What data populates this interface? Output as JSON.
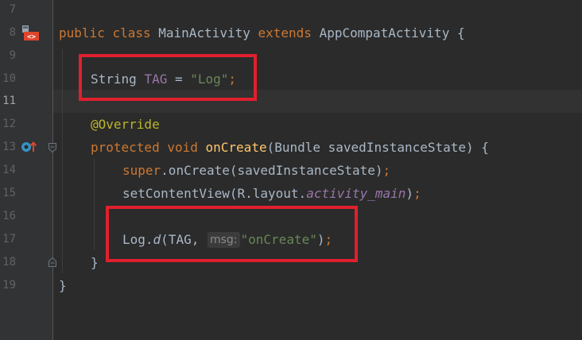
{
  "editor": {
    "line_numbers": [
      "7",
      "8",
      "9",
      "10",
      "11",
      "12",
      "13",
      "14",
      "15",
      "16",
      "17",
      "18",
      "19"
    ],
    "current_line": "11",
    "code": {
      "l8": {
        "kw1": "public",
        "kw2": "class",
        "name": "MainActivity",
        "kw3": "extends",
        "super_name": "AppCompatActivity",
        "brace": "{"
      },
      "l10": {
        "type": "String",
        "field": "TAG",
        "eq": " = ",
        "value": "\"Log\"",
        "semi": ";"
      },
      "l12": {
        "annotation": "@Override"
      },
      "l13": {
        "kw1": "protected",
        "kw2": "void",
        "method": "onCreate",
        "params": "(Bundle savedInstanceState) {"
      },
      "l14": {
        "kw": "super",
        "rest": ".onCreate(savedInstanceState)",
        "semi": ";"
      },
      "l15": {
        "call": "setContentView(R.layout.",
        "field": "activity_main",
        "close": ")",
        "semi": ";"
      },
      "l17": {
        "obj": "Log.",
        "method": "d",
        "open": "(TAG, ",
        "hint": "msg:",
        "value": "\"onCreate\"",
        "close": ")",
        "semi": ";"
      },
      "l18": {
        "brace": "}"
      },
      "l19": {
        "brace": "}"
      }
    },
    "colors": {
      "background": "#2b2b2b",
      "gutter": "#313335",
      "keyword": "#cc7832",
      "string": "#6a8759",
      "field": "#9876aa",
      "annotation": "#bbb529",
      "method": "#ffc66d",
      "text": "#a9b7c6",
      "highlight_box": "#e0202e"
    },
    "gutter_icons": {
      "line8": "class-layout-icon",
      "line13": "override-method-icon",
      "line13_fold": "fold-start-icon",
      "line18_fold": "fold-end-icon"
    }
  }
}
